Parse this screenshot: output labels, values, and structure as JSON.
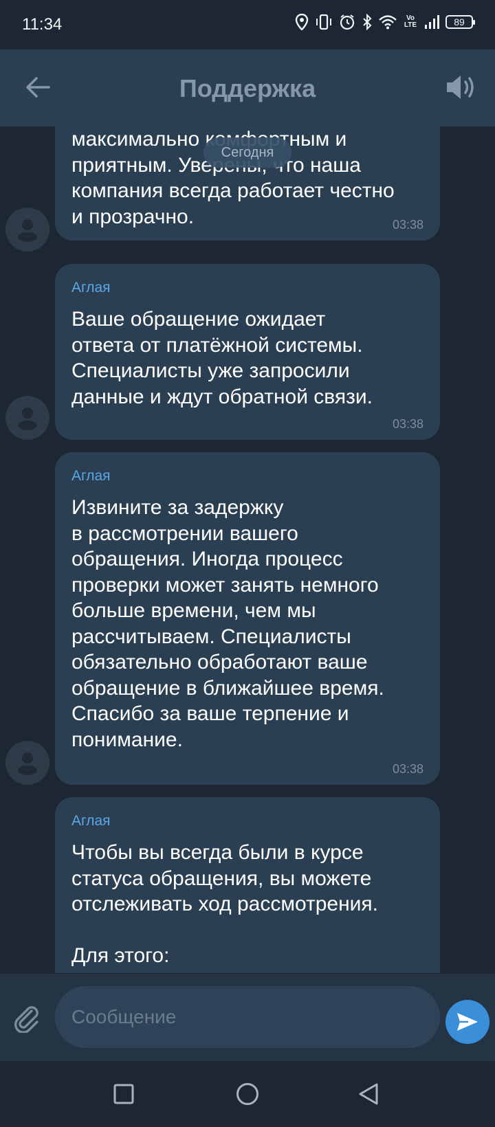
{
  "status_bar": {
    "time": "11:34",
    "volte": "Vo LTE",
    "battery": "89"
  },
  "header": {
    "title": "Поддержка"
  },
  "chat": {
    "date_pill": "Сегодня",
    "messages": [
      {
        "sender": "",
        "text": "максимально комфортным и\nприятным. Уверены, что наша\nкомпания всегда работает честно\nи прозрачно.",
        "time": "03:38"
      },
      {
        "sender": "Аглая",
        "text": "Ваше обращение ожидает\nответа от платёжной системы.\nСпециалисты уже запросили\nданные и ждут обратной связи.",
        "time": "03:38"
      },
      {
        "sender": "Аглая",
        "text": "Извините за задержку\nв рассмотрении вашего\nобращения. Иногда процесс\nпроверки может занять немного\nбольше времени, чем мы\nрассчитываем. Специалисты\nобязательно обработают ваше\nобращение в ближайшее время.\nСпасибо за ваше терпение и\nпонимание.",
        "time": "03:38"
      },
      {
        "sender": "Аглая",
        "text": "Чтобы вы всегда были в курсе\nстатуса обращения, вы можете\nотслеживать ход рассмотрения.\n\nДля этого:",
        "time": ""
      }
    ]
  },
  "input": {
    "placeholder": "Сообщение"
  },
  "icons": {
    "back": "arrow-left-icon",
    "sound": "speaker-icon",
    "attach": "paperclip-icon",
    "send": "send-icon",
    "avatar": "person-icon",
    "nav": [
      "square-icon",
      "circle-icon",
      "triangle-back-icon"
    ]
  },
  "colors": {
    "background": "#1d2733",
    "bubble": "#2b3f53",
    "accent": "#3b8ed8",
    "sender": "#5aa7e6"
  }
}
